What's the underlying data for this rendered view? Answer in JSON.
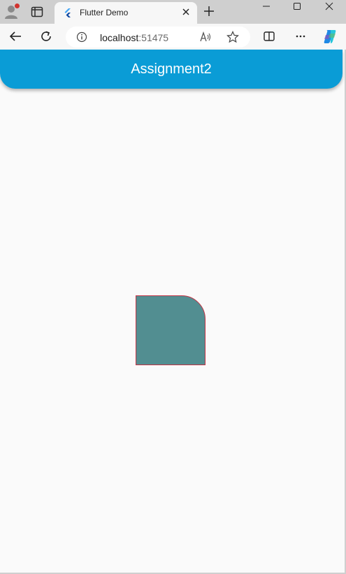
{
  "browser": {
    "tab": {
      "title": "Flutter Demo"
    },
    "address": {
      "host": "localhost",
      "port": ":51475"
    }
  },
  "app": {
    "title": "Assignment2",
    "colors": {
      "appbar": "#0a9cd6",
      "shape_fill": "#528e91",
      "shape_border": "#c13344",
      "background": "#fafafa"
    }
  },
  "icons": {
    "profile": "profile-icon",
    "tab_actions": "tab-actions-icon",
    "flutter": "flutter-icon",
    "close": "close-icon",
    "new_tab": "plus-icon",
    "minimize": "minimize-icon",
    "maximize": "maximize-icon",
    "window_close": "window-close-icon",
    "back": "back-arrow-icon",
    "refresh": "refresh-icon",
    "info": "info-icon",
    "read_aloud": "read-aloud-icon",
    "favorite": "star-icon",
    "split_screen": "split-screen-icon",
    "more": "more-icon",
    "copilot": "copilot-icon"
  }
}
